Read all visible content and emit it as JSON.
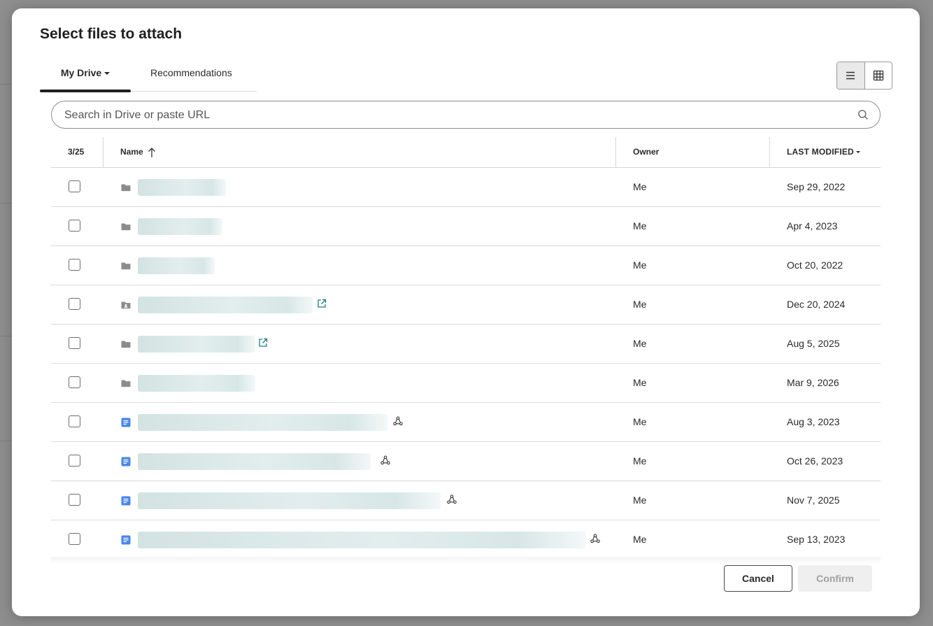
{
  "dialog": {
    "title": "Select files to attach"
  },
  "tabs": [
    {
      "label": "My Drive",
      "active": true
    },
    {
      "label": "Recommendations",
      "active": false
    }
  ],
  "view_toggle": {
    "list_icon": "list-icon",
    "grid_icon": "grid-icon",
    "active": "list"
  },
  "search": {
    "placeholder": "Search in Drive or paste URL",
    "value": "",
    "icon": "search-icon"
  },
  "table": {
    "headers": {
      "count": "3/25",
      "name": "Name",
      "owner": "Owner",
      "last_modified": "LAST MODIFIED"
    },
    "sort": {
      "column": "name",
      "direction": "ascending"
    },
    "rows": [
      {
        "type": "folder",
        "owner": "Me",
        "modified": "Sep 29, 2022"
      },
      {
        "type": "folder",
        "owner": "Me",
        "modified": "Apr 4, 2023"
      },
      {
        "type": "folder",
        "owner": "Me",
        "modified": "Oct 20, 2022"
      },
      {
        "type": "shared-folder",
        "owner": "Me",
        "modified": "Dec 20, 2024",
        "badge": "external-link-icon"
      },
      {
        "type": "folder",
        "owner": "Me",
        "modified": "Aug 5, 2025",
        "badge": "external-link-icon"
      },
      {
        "type": "folder",
        "owner": "Me",
        "modified": "Mar 9, 2026"
      },
      {
        "type": "doc",
        "owner": "Me",
        "modified": "Aug 3, 2023",
        "badge": "shared-icon"
      },
      {
        "type": "doc",
        "owner": "Me",
        "modified": "Oct 26, 2023",
        "badge": "shared-icon"
      },
      {
        "type": "doc",
        "owner": "Me",
        "modified": "Nov 7, 2025",
        "badge": "shared-icon"
      },
      {
        "type": "doc",
        "owner": "Me",
        "modified": "Sep 13, 2023",
        "badge": "shared-icon"
      }
    ]
  },
  "footer": {
    "cancel_label": "Cancel",
    "confirm_label": "Confirm",
    "confirm_disabled": true
  },
  "colors": {
    "doc_icon": "#4a86e8",
    "folder_icon": "#8c8c8c",
    "link_icon": "#1a7a8a",
    "accent": "#1f1f1f"
  }
}
